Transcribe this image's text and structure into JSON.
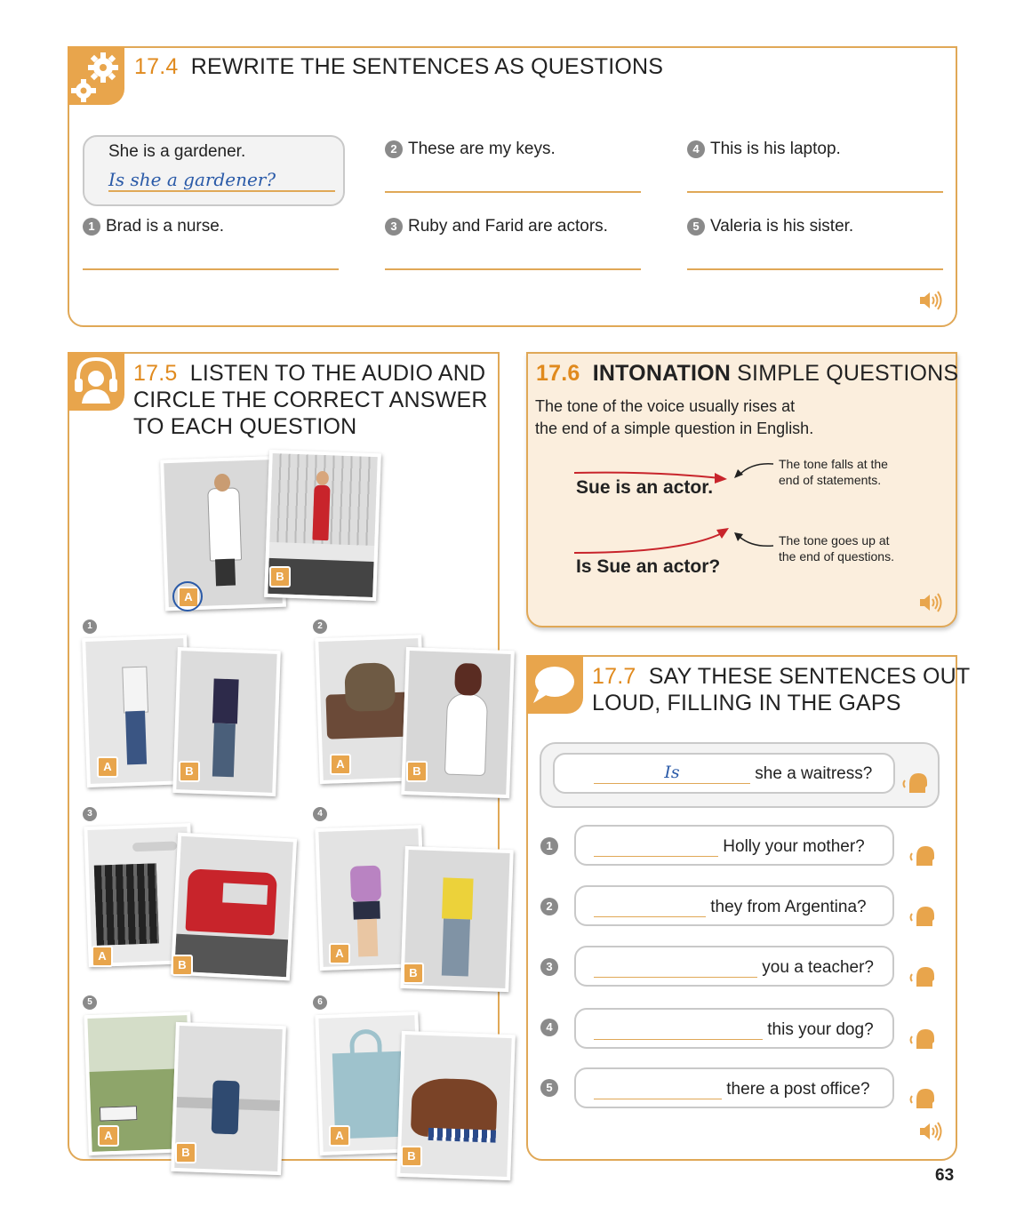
{
  "ex174": {
    "number": "17.4",
    "title": "REWRITE THE SENTENCES AS QUESTIONS",
    "example": {
      "prompt": "She is a gardener.",
      "answer": "Is she a gardener?"
    },
    "items": [
      {
        "n": "1",
        "text": "Brad is a nurse."
      },
      {
        "n": "2",
        "text": "These are my keys."
      },
      {
        "n": "3",
        "text": "Ruby and Farid are actors."
      },
      {
        "n": "4",
        "text": "This is his laptop."
      },
      {
        "n": "5",
        "text": "Valeria is his sister."
      }
    ]
  },
  "ex175": {
    "number": "17.5",
    "title_l1": "LISTEN TO THE AUDIO AND",
    "title_l2": "CIRCLE THE CORRECT ANSWER",
    "title_l3": "TO EACH QUESTION",
    "labels": {
      "a": "A",
      "b": "B"
    },
    "items": [
      "1",
      "2",
      "3",
      "4",
      "5",
      "6"
    ]
  },
  "ex176": {
    "number": "17.6",
    "title_bold": "INTONATION",
    "title_rest": "SIMPLE QUESTIONS",
    "body_l1": "The tone of the voice usually rises at",
    "body_l2": "the end of a simple question in English.",
    "statement": "Sue is an actor.",
    "statement_note_l1": "The tone falls at the",
    "statement_note_l2": "end of statements.",
    "question": "Is Sue an actor?",
    "question_note_l1": "The tone goes up at",
    "question_note_l2": "the end of questions."
  },
  "ex177": {
    "number": "17.7",
    "title_l1": "SAY THESE SENTENCES OUT",
    "title_l2": "LOUD, FILLING IN THE GAPS",
    "example": {
      "answer": "Is",
      "rest": "she a waitress?"
    },
    "items": [
      {
        "n": "1",
        "rest": "Holly your mother?"
      },
      {
        "n": "2",
        "rest": "they from Argentina?"
      },
      {
        "n": "3",
        "rest": "you a teacher?"
      },
      {
        "n": "4",
        "rest": "this your dog?"
      },
      {
        "n": "5",
        "rest": "there a post office?"
      }
    ]
  },
  "page_number": "63",
  "colors": {
    "accent": "#e8a54c",
    "number": "#e08a1e",
    "answer_blue": "#2a5aa8",
    "tone_red": "#c8242b",
    "panel_bg": "#fbeedd"
  }
}
